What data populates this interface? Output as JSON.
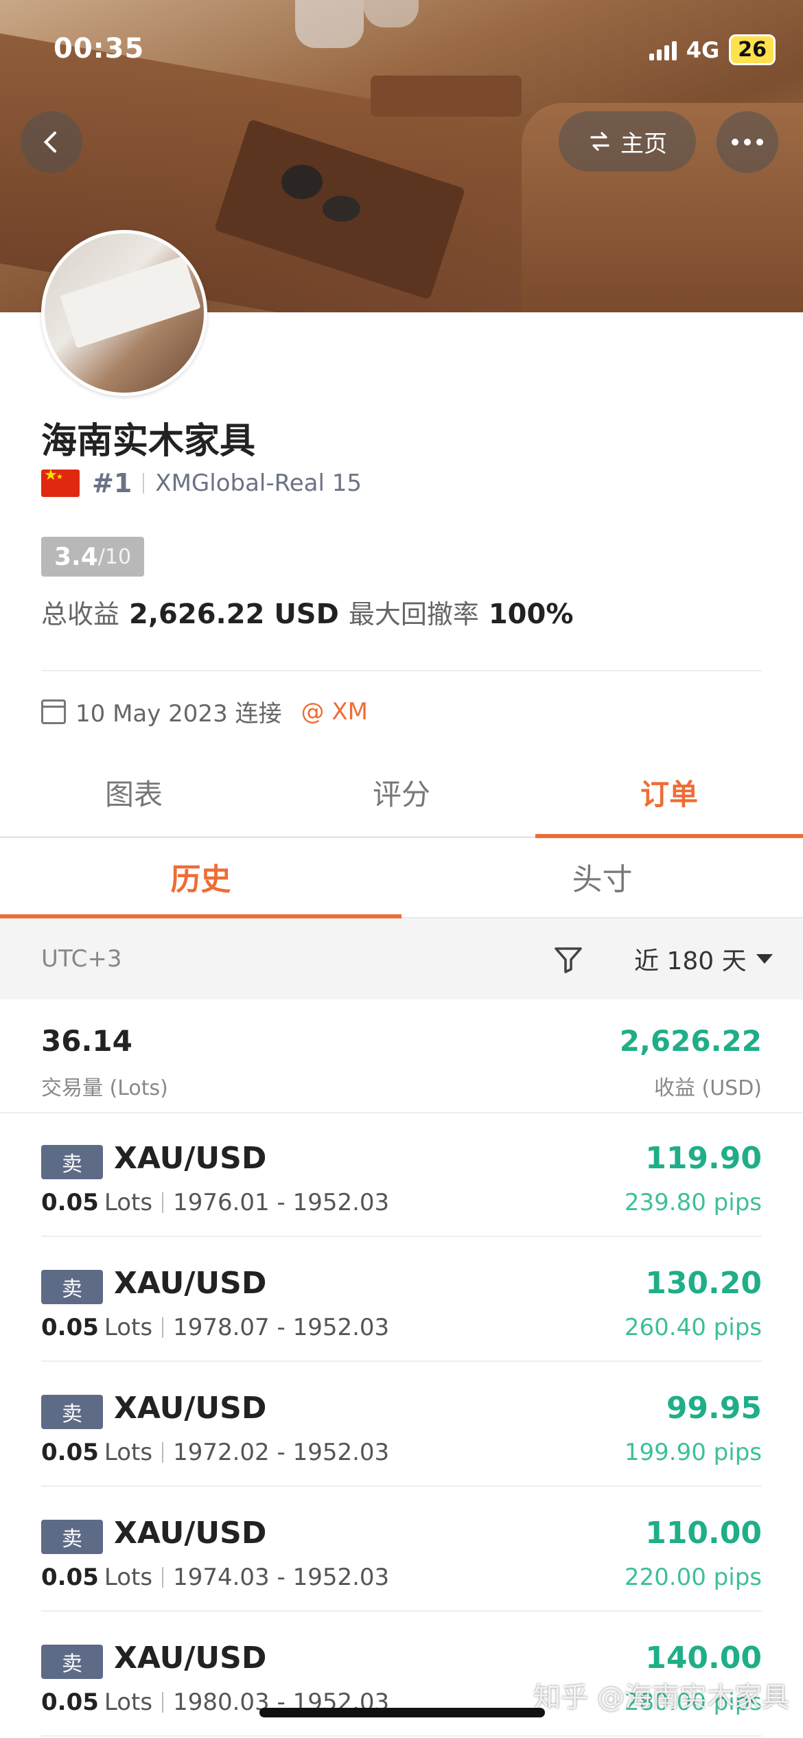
{
  "status_bar": {
    "time": "00:35",
    "network": "4G",
    "battery": "26"
  },
  "nav": {
    "home_label": "主页"
  },
  "profile": {
    "name": "海南实木家具",
    "rank": "#1",
    "server": "XMGlobal-Real 15",
    "score": "3.4",
    "score_max": "/10",
    "total_profit_label": "总收益",
    "total_profit": "2,626.22 USD",
    "max_drawdown_label": "最大回撤率",
    "max_drawdown": "100%",
    "connected_date": "10 May 2023 连接",
    "broker": "@ XM"
  },
  "tabs": [
    "图表",
    "评分",
    "订单"
  ],
  "subtabs": [
    "历史",
    "头寸"
  ],
  "filter": {
    "timezone": "UTC+3",
    "period": "近 180 天"
  },
  "summary": {
    "lots": "36.14",
    "lots_label": "交易量 (Lots)",
    "profit": "2,626.22",
    "profit_label": "收益 (USD)"
  },
  "orders": [
    {
      "side": "卖",
      "symbol": "XAU/USD",
      "lots": "0.05",
      "lots_unit": "Lots",
      "range": "1976.01 - 1952.03",
      "profit": "119.90",
      "pips": "239.80 pips"
    },
    {
      "side": "卖",
      "symbol": "XAU/USD",
      "lots": "0.05",
      "lots_unit": "Lots",
      "range": "1978.07 - 1952.03",
      "profit": "130.20",
      "pips": "260.40 pips"
    },
    {
      "side": "卖",
      "symbol": "XAU/USD",
      "lots": "0.05",
      "lots_unit": "Lots",
      "range": "1972.02 - 1952.03",
      "profit": "99.95",
      "pips": "199.90 pips"
    },
    {
      "side": "卖",
      "symbol": "XAU/USD",
      "lots": "0.05",
      "lots_unit": "Lots",
      "range": "1974.03 - 1952.03",
      "profit": "110.00",
      "pips": "220.00 pips"
    },
    {
      "side": "卖",
      "symbol": "XAU/USD",
      "lots": "0.05",
      "lots_unit": "Lots",
      "range": "1980.03 - 1952.03",
      "profit": "140.00",
      "pips": "280.00 pips"
    }
  ],
  "watermark": "知乎 @海南实木家具",
  "colors": {
    "accent": "#ef6c35",
    "profit": "#1fae88",
    "sell_badge": "#5d6b86"
  }
}
